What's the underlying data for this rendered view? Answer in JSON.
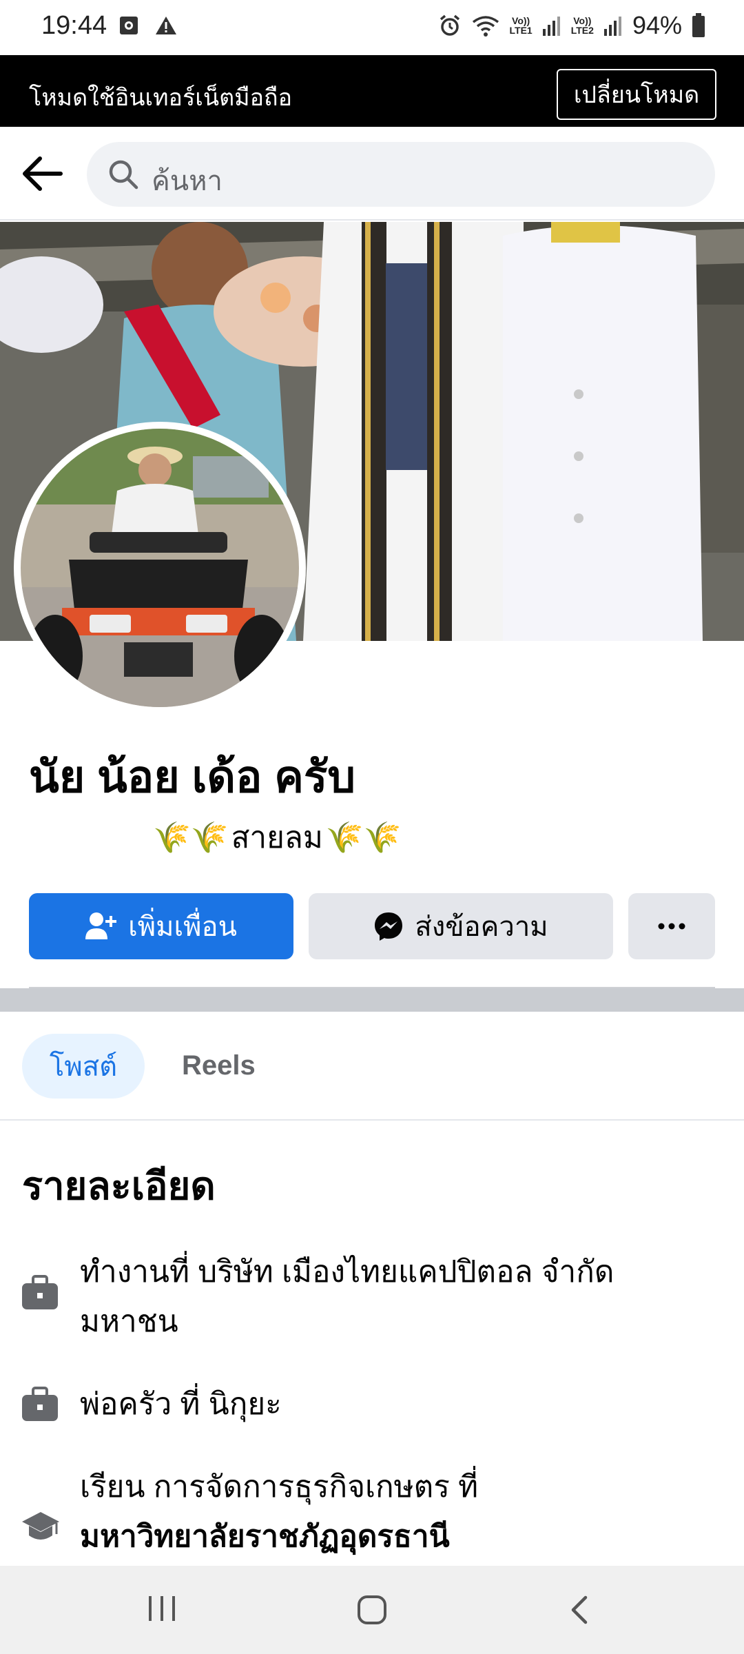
{
  "status_bar": {
    "time": "19:44",
    "battery": "94%",
    "sim1": [
      "Vo))",
      "LTE1"
    ],
    "sim2": [
      "Vo))",
      "LTE2"
    ]
  },
  "mode_banner": {
    "text": "โหมดใช้อินเทอร์เน็ตมือถือ",
    "button": "เปลี่ยนโหมด"
  },
  "search": {
    "placeholder": "ค้นหา"
  },
  "profile": {
    "name": "นัย น้อย เด้อ ครับ",
    "bio": "สายลม",
    "bio_emoji_left": "🌾🌾",
    "bio_emoji_right": "🌾🌾"
  },
  "actions": {
    "add_friend": "เพิ่มเพื่อน",
    "message": "ส่งข้อความ",
    "more": "···"
  },
  "tabs": [
    {
      "label": "โพสต์",
      "active": true
    },
    {
      "label": "Reels",
      "active": false
    }
  ],
  "details": {
    "title": "รายละเอียด",
    "items": [
      {
        "icon": "briefcase-icon",
        "line1": "ทำงานที่ บริษัท เมืองไทยแคปปิตอล จำกัด",
        "line2": "มหาชน"
      },
      {
        "icon": "briefcase-icon",
        "line1": "พ่อครัว ที่ นิกุยะ"
      },
      {
        "icon": "graduation-cap-icon",
        "line1": "เรียน การจัดการธุรกิจเกษตร ที่",
        "line2_bold": "มหาวิทยาลัยราชภัฏอุดรธานี"
      }
    ]
  },
  "colors": {
    "accent": "#1b74e4",
    "banner_bg": "#000000",
    "secondary_button": "#e4e6eb"
  }
}
